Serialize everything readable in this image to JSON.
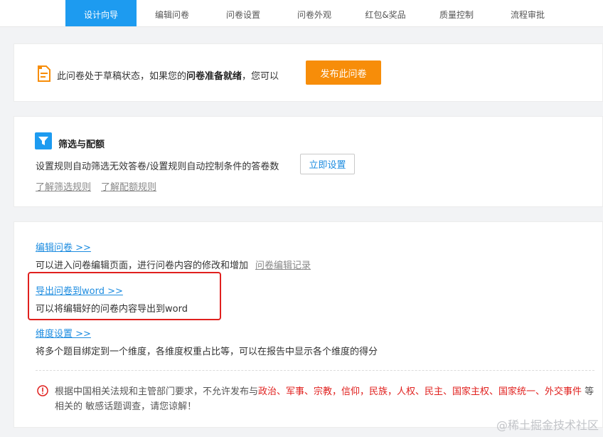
{
  "nav": {
    "tabs": [
      {
        "label": "设计向导",
        "active": true,
        "icon": "design-wizard-icon"
      },
      {
        "label": "编辑问卷",
        "active": false,
        "icon": "edit-icon"
      },
      {
        "label": "问卷设置",
        "active": false,
        "icon": "settings-icon"
      },
      {
        "label": "问卷外观",
        "active": false,
        "icon": "appearance-icon"
      },
      {
        "label": "红包&奖品",
        "active": false,
        "icon": "gift-icon"
      },
      {
        "label": "质量控制",
        "active": false,
        "icon": "shield-icon"
      },
      {
        "label": "流程审批",
        "active": false,
        "icon": "approval-icon"
      }
    ]
  },
  "draft": {
    "text_before": "此问卷处于草稿状态，如果您的",
    "text_bold": "问卷准备就绪",
    "text_after": "，您可以",
    "publish_label": "发布此问卷"
  },
  "filter": {
    "title": "筛选与配额",
    "desc": "设置规则自动筛选无效答卷/设置规则自动控制条件的答卷数",
    "setup_label": "立即设置",
    "link_filter": "了解筛选规则",
    "link_quota": "了解配额规则"
  },
  "actions": {
    "edit_link": "编辑问卷 >>",
    "edit_desc": "可以进入问卷编辑页面，进行问卷内容的修改和增加",
    "edit_history": "问卷编辑记录",
    "export_link": "导出问卷到word >>",
    "export_desc": "可以将编辑好的问卷内容导出到word",
    "dimension_link": "维度设置 >>",
    "dimension_desc": "将多个题目绑定到一个维度，各维度权重占比等，可以在报告中显示各个维度的得分"
  },
  "notice": {
    "prefix": "根据中国相关法规和主管部门要求，不允许发布与",
    "topics": "政治、军事、宗教，信仰，民族，人权、民主、国家主权、国家统一、外交事件",
    "suffix": " 等相关的 敏感话题调查，请您谅解！"
  },
  "watermark": "@稀土掘金技术社区",
  "colors": {
    "accent": "#1d9bf0",
    "publish": "#f78d09",
    "highlight_box": "#e0201e",
    "link": "#1d8ce0"
  }
}
